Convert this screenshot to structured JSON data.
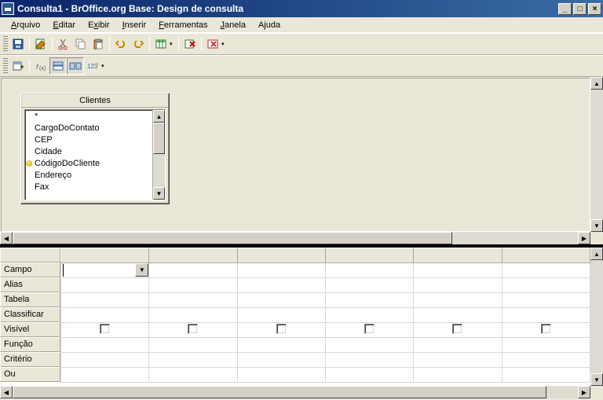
{
  "window": {
    "title": "Consulta1 - BrOffice.org Base: Design de consulta"
  },
  "menu": {
    "items": [
      {
        "label": "Arquivo",
        "u": 0
      },
      {
        "label": "Editar",
        "u": 0
      },
      {
        "label": "Exibir",
        "u": 1
      },
      {
        "label": "Inserir",
        "u": 0
      },
      {
        "label": "Ferramentas",
        "u": 0
      },
      {
        "label": "Janela",
        "u": 0
      },
      {
        "label": "Ajuda",
        "u": 1
      }
    ]
  },
  "table_box": {
    "name": "Clientes",
    "fields": [
      {
        "name": "*",
        "key": false
      },
      {
        "name": "CargoDoContato",
        "key": false
      },
      {
        "name": "CEP",
        "key": false
      },
      {
        "name": "Cidade",
        "key": false
      },
      {
        "name": "CódigoDoCliente",
        "key": true
      },
      {
        "name": "Endereço",
        "key": false
      },
      {
        "name": "Fax",
        "key": false
      }
    ]
  },
  "grid": {
    "rows": [
      "Campo",
      "Alias",
      "Tabela",
      "Classificar",
      "Visível",
      "Função",
      "Critério",
      "Ou"
    ],
    "columns": 6
  },
  "icons": {
    "min": "_",
    "max": "□",
    "close": "×",
    "up": "▲",
    "down": "▼",
    "left": "◀",
    "right": "▶",
    "tri": "▾"
  }
}
